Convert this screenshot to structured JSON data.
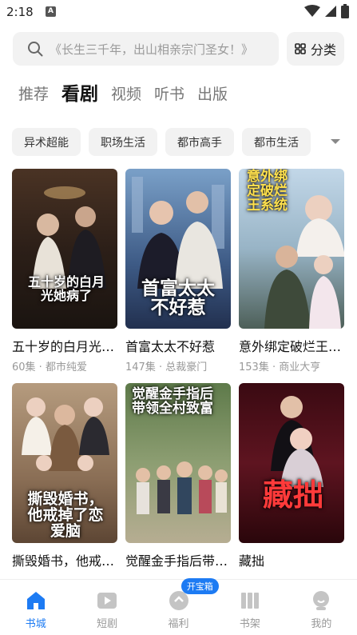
{
  "status_bar": {
    "time": "2:18",
    "notification": "A"
  },
  "search": {
    "placeholder": "《长生三千年，出山相亲宗门圣女！》",
    "category_label": "分类"
  },
  "tabs": [
    {
      "label": "推荐",
      "active": false
    },
    {
      "label": "看剧",
      "active": true
    },
    {
      "label": "视频",
      "active": false
    },
    {
      "label": "听书",
      "active": false
    },
    {
      "label": "出版",
      "active": false
    }
  ],
  "chips": [
    "异术超能",
    "职场生活",
    "都市高手",
    "都市生活"
  ],
  "dramas": [
    {
      "title": "五十岁的白月光她病了",
      "meta": "60集 · 都市纯爱",
      "cover_text": "五十岁的白月光她病了"
    },
    {
      "title": "首富太太不好惹",
      "meta": "147集 · 总裁豪门",
      "cover_text": "首富太太不好惹"
    },
    {
      "title": "意外绑定破烂王系统",
      "meta": "153集 · 商业大亨",
      "cover_text": "意外绑定破烂王系统"
    },
    {
      "title": "撕毁婚书，他戒掉了恋爱脑",
      "meta": "",
      "cover_text": "撕毁婚书，他戒掉了恋爱脑"
    },
    {
      "title": "觉醒金手指后带领全村致富",
      "meta": "",
      "cover_text": "觉醒金手指后带领全村致富"
    },
    {
      "title": "藏拙",
      "meta": "",
      "cover_text": "藏拙"
    }
  ],
  "bottom_nav": [
    {
      "label": "书城",
      "icon": "home-icon",
      "active": true
    },
    {
      "label": "短剧",
      "icon": "play-icon",
      "active": false
    },
    {
      "label": "福利",
      "icon": "gift-icon",
      "active": false,
      "badge": "开宝箱"
    },
    {
      "label": "书架",
      "icon": "bookshelf-icon",
      "active": false
    },
    {
      "label": "我的",
      "icon": "profile-icon",
      "active": false
    }
  ],
  "colors": {
    "accent": "#1d7bf3",
    "chip_bg": "#f2f2f2",
    "muted_text": "#999999"
  }
}
